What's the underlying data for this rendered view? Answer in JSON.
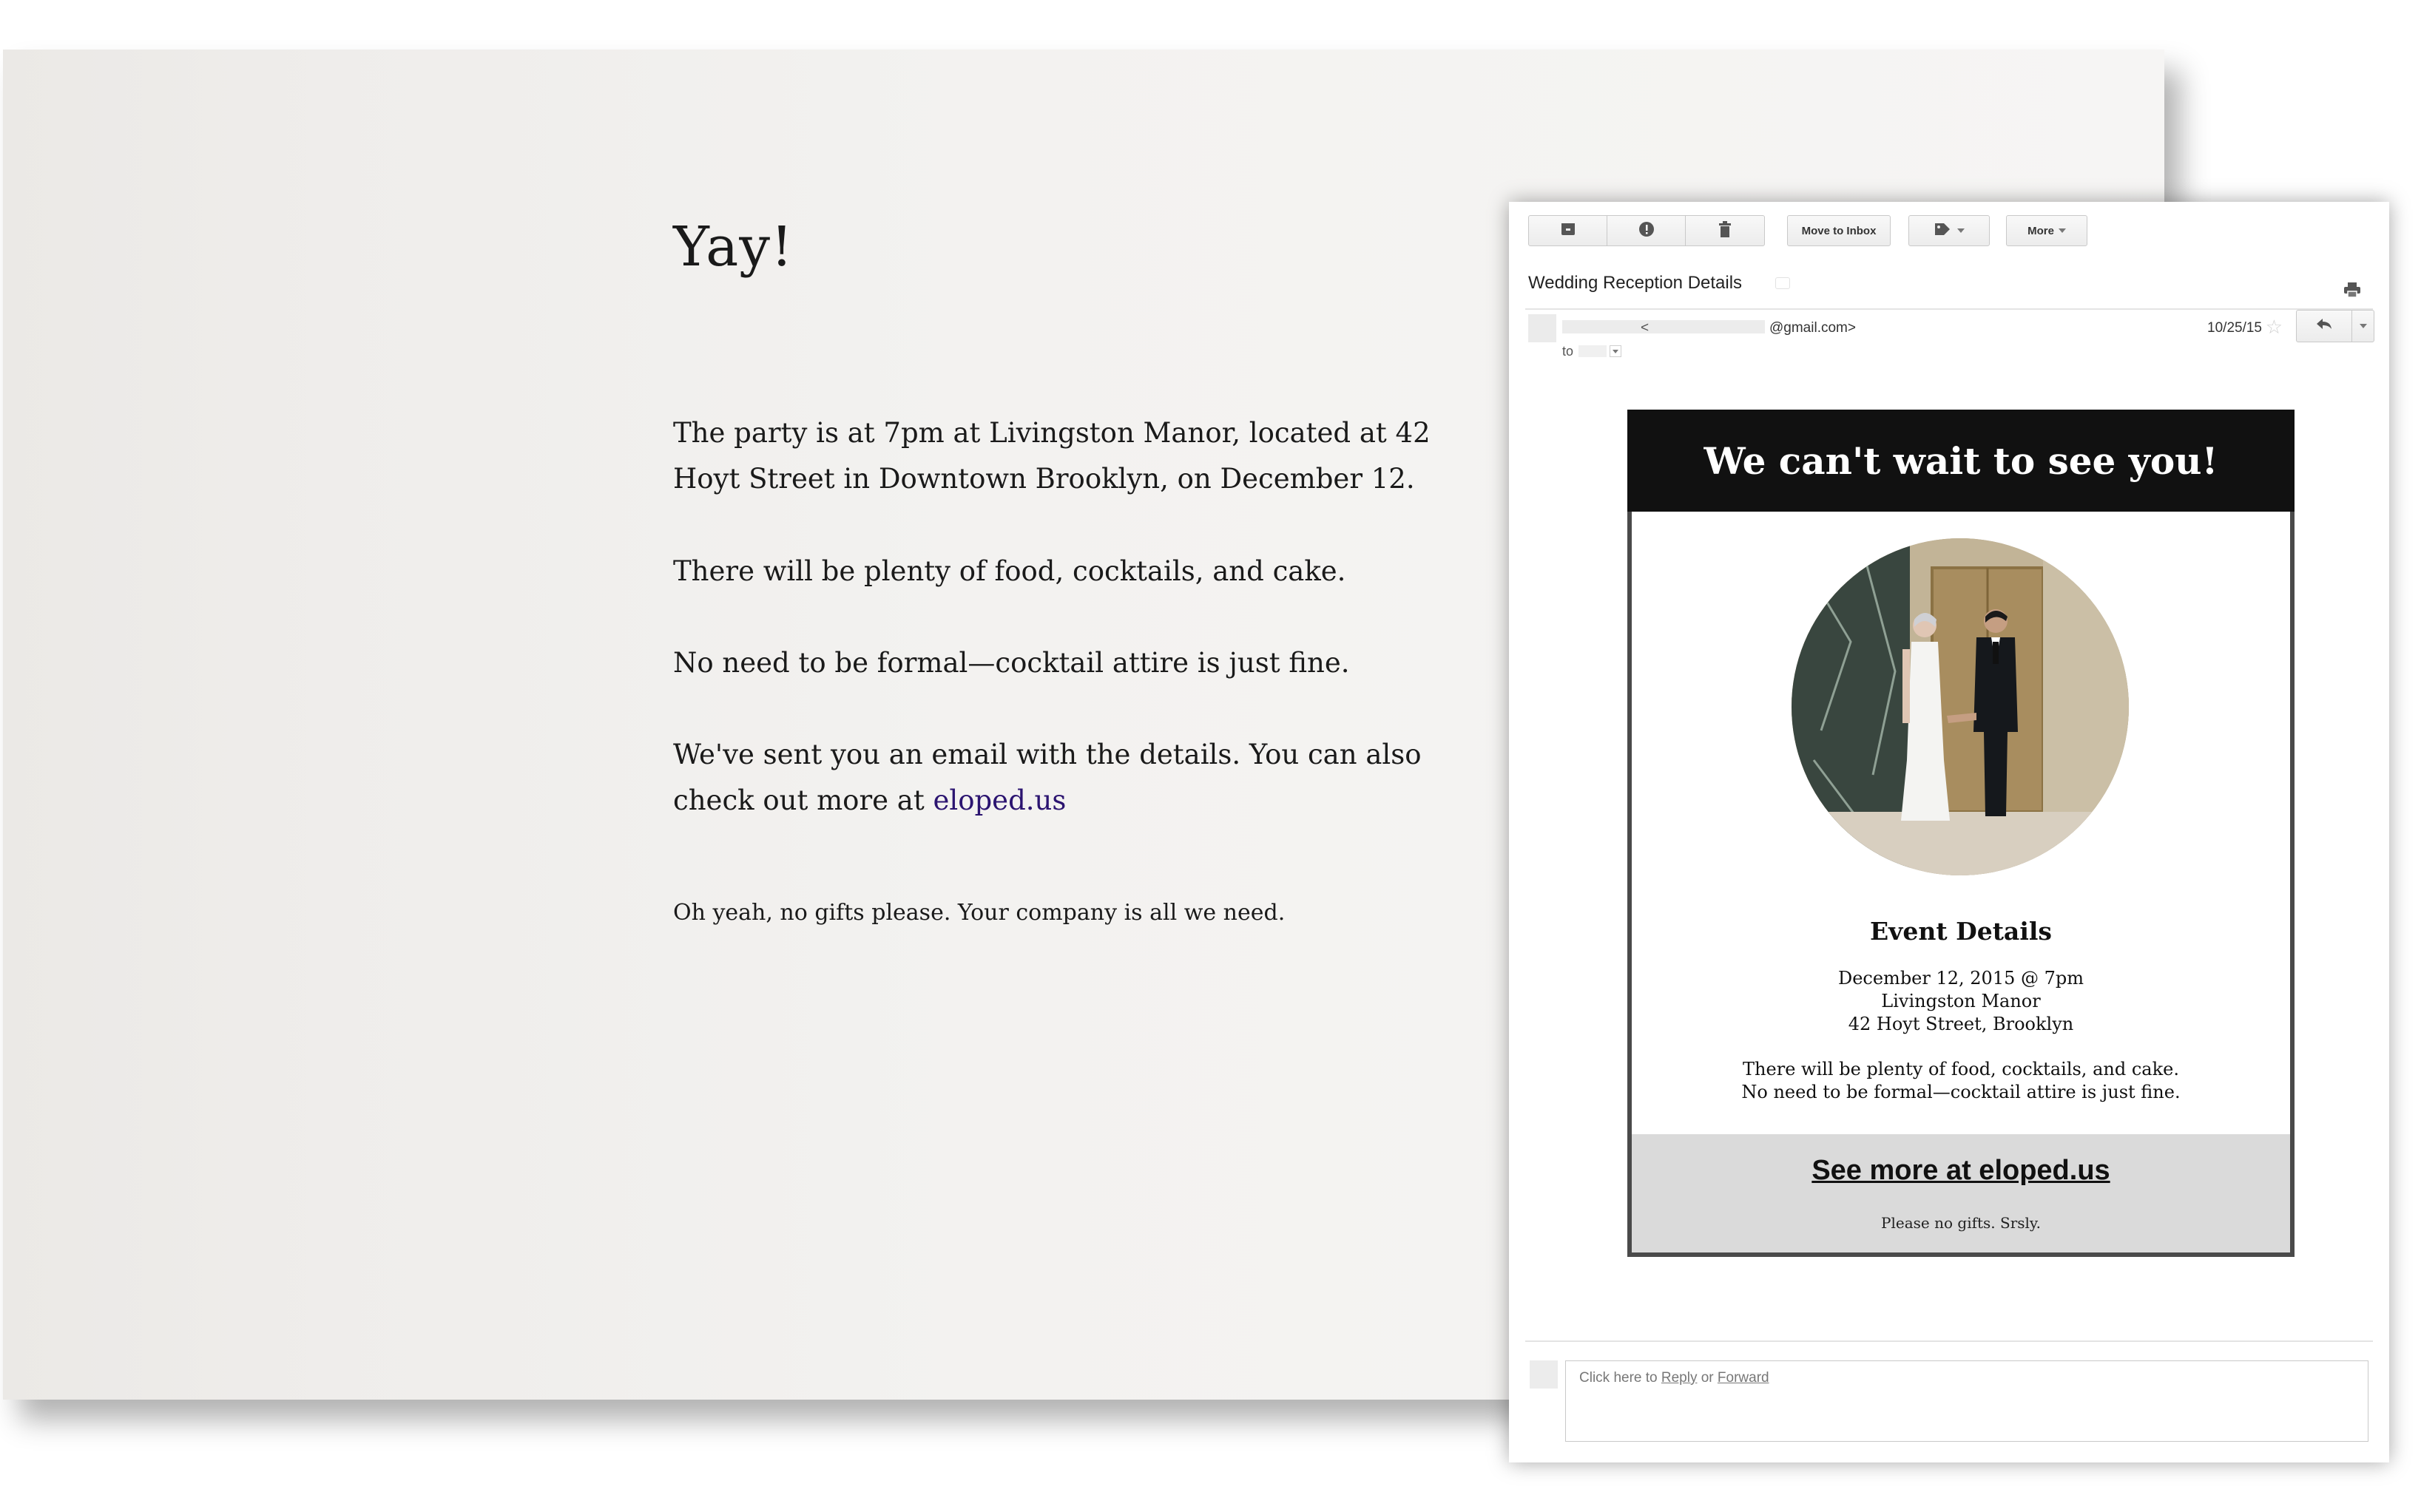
{
  "confirmation": {
    "heading": "Yay!",
    "paragraph1": "The party is at 7pm at Livingston Manor, located at 42 Hoyt Street in Downtown Brooklyn, on December 12.",
    "paragraph2": "There will be plenty of food, cocktails, and cake.",
    "paragraph3": "No need to be formal—cocktail attire is just fine.",
    "paragraph4_prefix": "We've sent you an email with the details. You can also check out more at ",
    "paragraph4_link": "eloped.us",
    "footnote": "Oh yeah, no gifts please. Your company is all we need."
  },
  "email_client": {
    "toolbar": {
      "archive_icon": "archive-icon",
      "spam_icon": "report-spam-icon",
      "delete_icon": "trash-icon",
      "move_to_inbox_label": "Move to Inbox",
      "labels_icon": "label-tag-icon",
      "more_label": "More"
    },
    "subject": "Wedding Reception Details",
    "sender": {
      "lt": "<",
      "email_suffix": "@gmail.com>",
      "to_label": "to"
    },
    "date": "10/25/15",
    "reply_prompt_prefix": "Click here to ",
    "reply_link": "Reply",
    "reply_or": " or ",
    "forward_link": "Forward"
  },
  "email_body": {
    "header": "We can't wait to see you!",
    "event_title": "Event Details",
    "date_line": "December 12, 2015 @ 7pm",
    "venue_line": "Livingston Manor",
    "address_line": "42 Hoyt Street, Brooklyn",
    "food_line": "There will be plenty of food, cocktails, and cake.",
    "attire_line": "No need to be formal—cocktail attire is just fine.",
    "see_more": "See more at eloped.us",
    "no_gifts": "Please no gifts. Srsly."
  },
  "colors": {
    "link": "#2b1470",
    "header_bg": "#111111",
    "footer_bg": "#dadada",
    "page_bg": "#f3f2f0"
  }
}
